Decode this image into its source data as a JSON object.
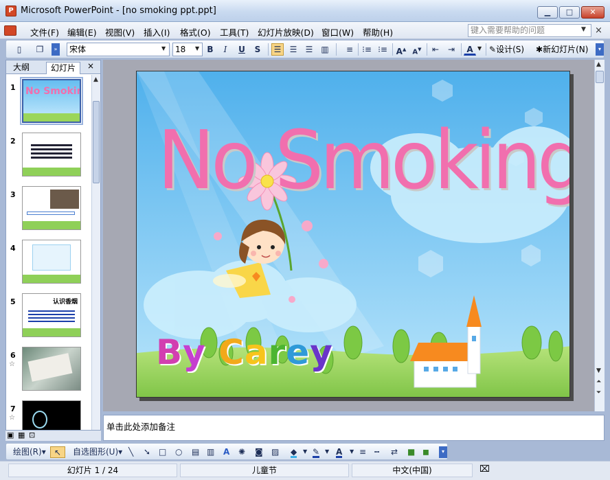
{
  "window": {
    "title": "Microsoft PowerPoint - [no smoking ppt.ppt]",
    "app_icon": "powerpoint-icon",
    "controls": {
      "minimize": "▁",
      "maximize": "□",
      "close": "✕"
    }
  },
  "menu": {
    "items": [
      "文件(F)",
      "编辑(E)",
      "视图(V)",
      "插入(I)",
      "格式(O)",
      "工具(T)",
      "幻灯片放映(D)",
      "窗口(W)",
      "帮助(H)"
    ],
    "help_placeholder": "键入需要帮助的问题",
    "close_glyph": "×"
  },
  "toolbar": {
    "font_name": "宋体",
    "font_size": "18",
    "bold": "B",
    "italic": "I",
    "underline": "U",
    "shadow": "S",
    "design_label": "设计(S)",
    "new_slide_label": "新幻灯片(N)"
  },
  "left_pane": {
    "tab_outline": "大纲",
    "tab_slides": "幻灯片",
    "close": "×",
    "slides": [
      {
        "number": "1",
        "star": false,
        "title": "No Smoking"
      },
      {
        "number": "2",
        "star": false,
        "title": ""
      },
      {
        "number": "3",
        "star": false,
        "title": ""
      },
      {
        "number": "4",
        "star": false,
        "title": ""
      },
      {
        "number": "5",
        "star": false,
        "title": "认识香烟"
      },
      {
        "number": "6",
        "star": true,
        "title": ""
      },
      {
        "number": "7",
        "star": true,
        "title": ""
      }
    ]
  },
  "slide": {
    "title": "No Smoking !",
    "byline": "By Carey",
    "byline_colors": [
      "#d23fb0",
      "#c53fcf",
      "#f2a91b",
      "#f7c41c",
      "#4cb531",
      "#2f9ad8",
      "#6a35c9",
      "#c92d8e"
    ]
  },
  "notes": {
    "placeholder": "单击此处添加备注"
  },
  "drawing_toolbar": {
    "draw_label": "绘图(R)",
    "autoshapes_label": "自选图形(U)"
  },
  "status": {
    "slide_indicator": "幻灯片 1 / 24",
    "design_name": "儿童节",
    "language": "中文(中国)"
  },
  "colors": {
    "sky_top": "#56b4ee",
    "sky_bottom": "#b5e3fb",
    "title_pink": "#f16fae",
    "grass": "#9bd65a",
    "ui_blue": "#c9daf0"
  }
}
